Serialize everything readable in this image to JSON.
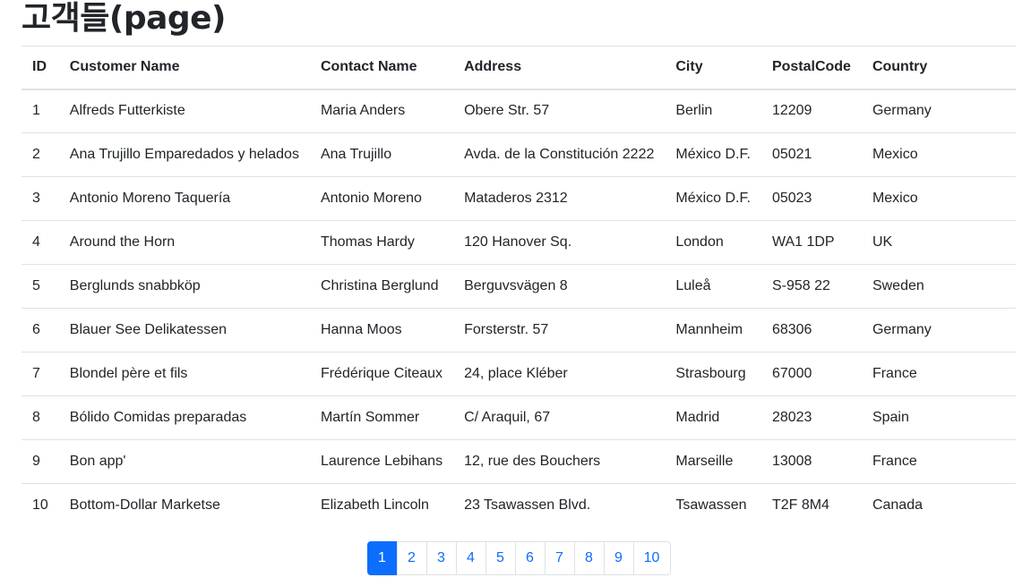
{
  "page": {
    "title": "고객들(page)"
  },
  "table": {
    "headers": {
      "id": "ID",
      "name": "Customer Name",
      "contact": "Contact Name",
      "address": "Address",
      "city": "City",
      "postal": "PostalCode",
      "country": "Country"
    },
    "rows": [
      {
        "id": "1",
        "name": "Alfreds Futterkiste",
        "contact": "Maria Anders",
        "address": "Obere Str. 57",
        "city": "Berlin",
        "postal": "12209",
        "country": "Germany"
      },
      {
        "id": "2",
        "name": "Ana Trujillo Emparedados y helados",
        "contact": "Ana Trujillo",
        "address": "Avda. de la Constitución 2222",
        "city": "México D.F.",
        "postal": "05021",
        "country": "Mexico"
      },
      {
        "id": "3",
        "name": "Antonio Moreno Taquería",
        "contact": "Antonio Moreno",
        "address": "Mataderos 2312",
        "city": "México D.F.",
        "postal": "05023",
        "country": "Mexico"
      },
      {
        "id": "4",
        "name": "Around the Horn",
        "contact": "Thomas Hardy",
        "address": "120 Hanover Sq.",
        "city": "London",
        "postal": "WA1 1DP",
        "country": "UK"
      },
      {
        "id": "5",
        "name": "Berglunds snabbköp",
        "contact": "Christina Berglund",
        "address": "Berguvsvägen 8",
        "city": "Luleå",
        "postal": "S-958 22",
        "country": "Sweden"
      },
      {
        "id": "6",
        "name": "Blauer See Delikatessen",
        "contact": "Hanna Moos",
        "address": "Forsterstr. 57",
        "city": "Mannheim",
        "postal": "68306",
        "country": "Germany"
      },
      {
        "id": "7",
        "name": "Blondel père et fils",
        "contact": "Frédérique Citeaux",
        "address": "24, place Kléber",
        "city": "Strasbourg",
        "postal": "67000",
        "country": "France"
      },
      {
        "id": "8",
        "name": "Bólido Comidas preparadas",
        "contact": "Martín Sommer",
        "address": "C/ Araquil, 67",
        "city": "Madrid",
        "postal": "28023",
        "country": "Spain"
      },
      {
        "id": "9",
        "name": "Bon app'",
        "contact": "Laurence Lebihans",
        "address": "12, rue des Bouchers",
        "city": "Marseille",
        "postal": "13008",
        "country": "France"
      },
      {
        "id": "10",
        "name": "Bottom-Dollar Marketse",
        "contact": "Elizabeth Lincoln",
        "address": "23 Tsawassen Blvd.",
        "city": "Tsawassen",
        "postal": "T2F 8M4",
        "country": "Canada"
      }
    ]
  },
  "pagination": {
    "pages": [
      "1",
      "2",
      "3",
      "4",
      "5",
      "6",
      "7",
      "8",
      "9",
      "10"
    ],
    "active": "1",
    "active_color": "#0d6efd",
    "link_color": "#0d6efd"
  }
}
